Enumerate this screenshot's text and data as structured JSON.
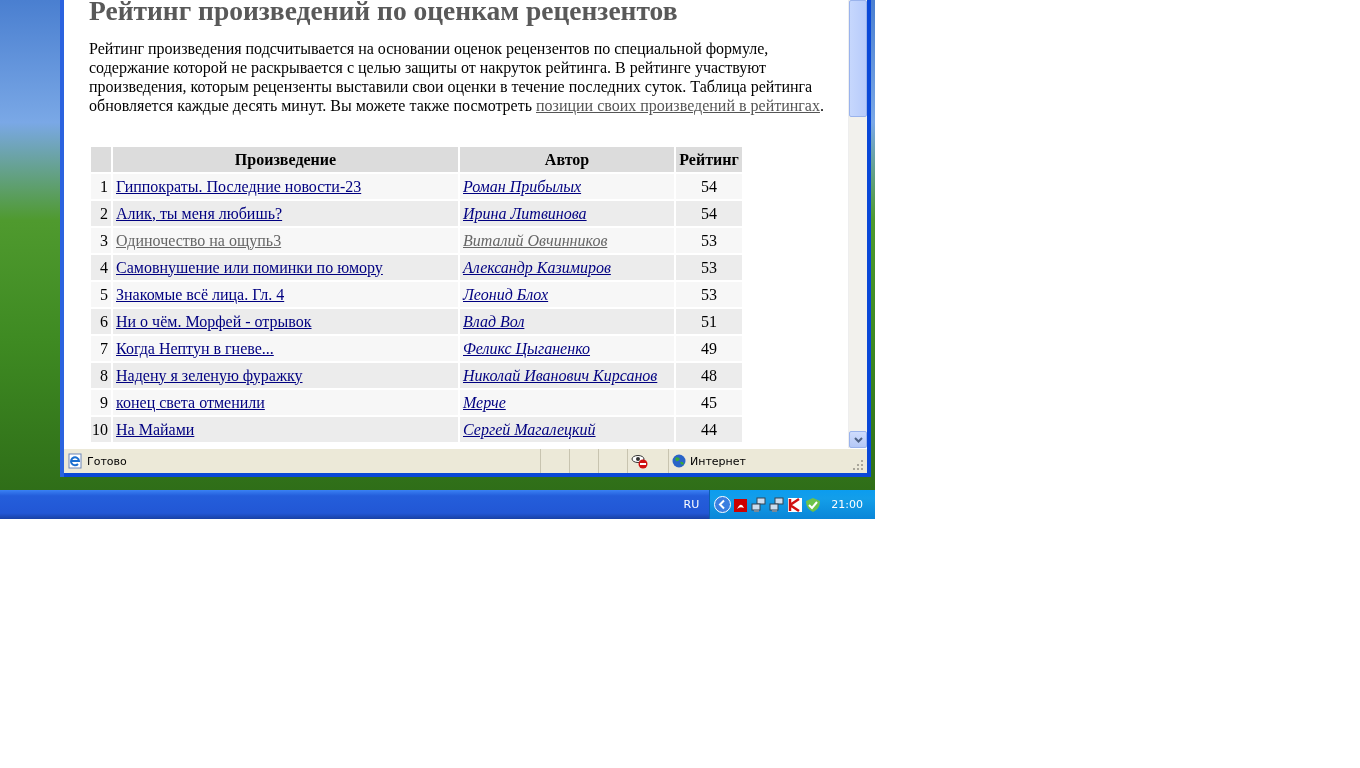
{
  "heading": "Рейтинг произведений по оценкам рецензентов",
  "intro": {
    "text": "Рейтинг произведения подсчитывается на основании оценок рецензентов по специальной формуле, содержание которой не раскрывается с целью защиты от накруток рейтинга. В рейтинге участвуют произведения, которым рецензенты выставили свои оценки в течение последних суток. Таблица рейтинга обновляется каждые десять минут. Вы можете также посмотреть",
    "link": "позиции своих произведений в рейтингах",
    "after": "."
  },
  "table": {
    "columns": [
      "Произведение",
      "Автор",
      "Рейтинг"
    ],
    "rows": [
      {
        "rank": "1",
        "title": "Гиппократы. Последние новости-23",
        "author": "Роман Прибылых",
        "rating": "54",
        "visited": false
      },
      {
        "rank": "2",
        "title": "Алик, ты меня любишь?",
        "author": "Ирина Литвинова",
        "rating": "54",
        "visited": false
      },
      {
        "rank": "3",
        "title": "Одиночество на ощупь3",
        "author": "Виталий Овчинников",
        "rating": "53",
        "visited": true
      },
      {
        "rank": "4",
        "title": "Самовнушение или поминки по юмору",
        "author": "Александр Казимиров",
        "rating": "53",
        "visited": false
      },
      {
        "rank": "5",
        "title": "Знакомые всё лица. Гл. 4",
        "author": "Леонид Блох",
        "rating": "53",
        "visited": false
      },
      {
        "rank": "6",
        "title": "Ни о чём. Морфей - отрывок",
        "author": "Влад Вол",
        "rating": "51",
        "visited": false
      },
      {
        "rank": "7",
        "title": "Когда Нептун в гневе...",
        "author": "Феликс Цыганенко",
        "rating": "49",
        "visited": false
      },
      {
        "rank": "8",
        "title": "Надену я зеленую фуражку",
        "author": "Николай Иванович Кирсанов",
        "rating": "48",
        "visited": false
      },
      {
        "rank": "9",
        "title": "конец света отменили",
        "author": "Мерче",
        "rating": "45",
        "visited": false
      },
      {
        "rank": "10",
        "title": "На Майами",
        "author": "Сергей Магалецкий",
        "rating": "44",
        "visited": false
      }
    ]
  },
  "status_bar": {
    "text": "Готово",
    "zone": "Интернет"
  },
  "taskbar": {
    "language": "RU",
    "clock": "21:00"
  }
}
